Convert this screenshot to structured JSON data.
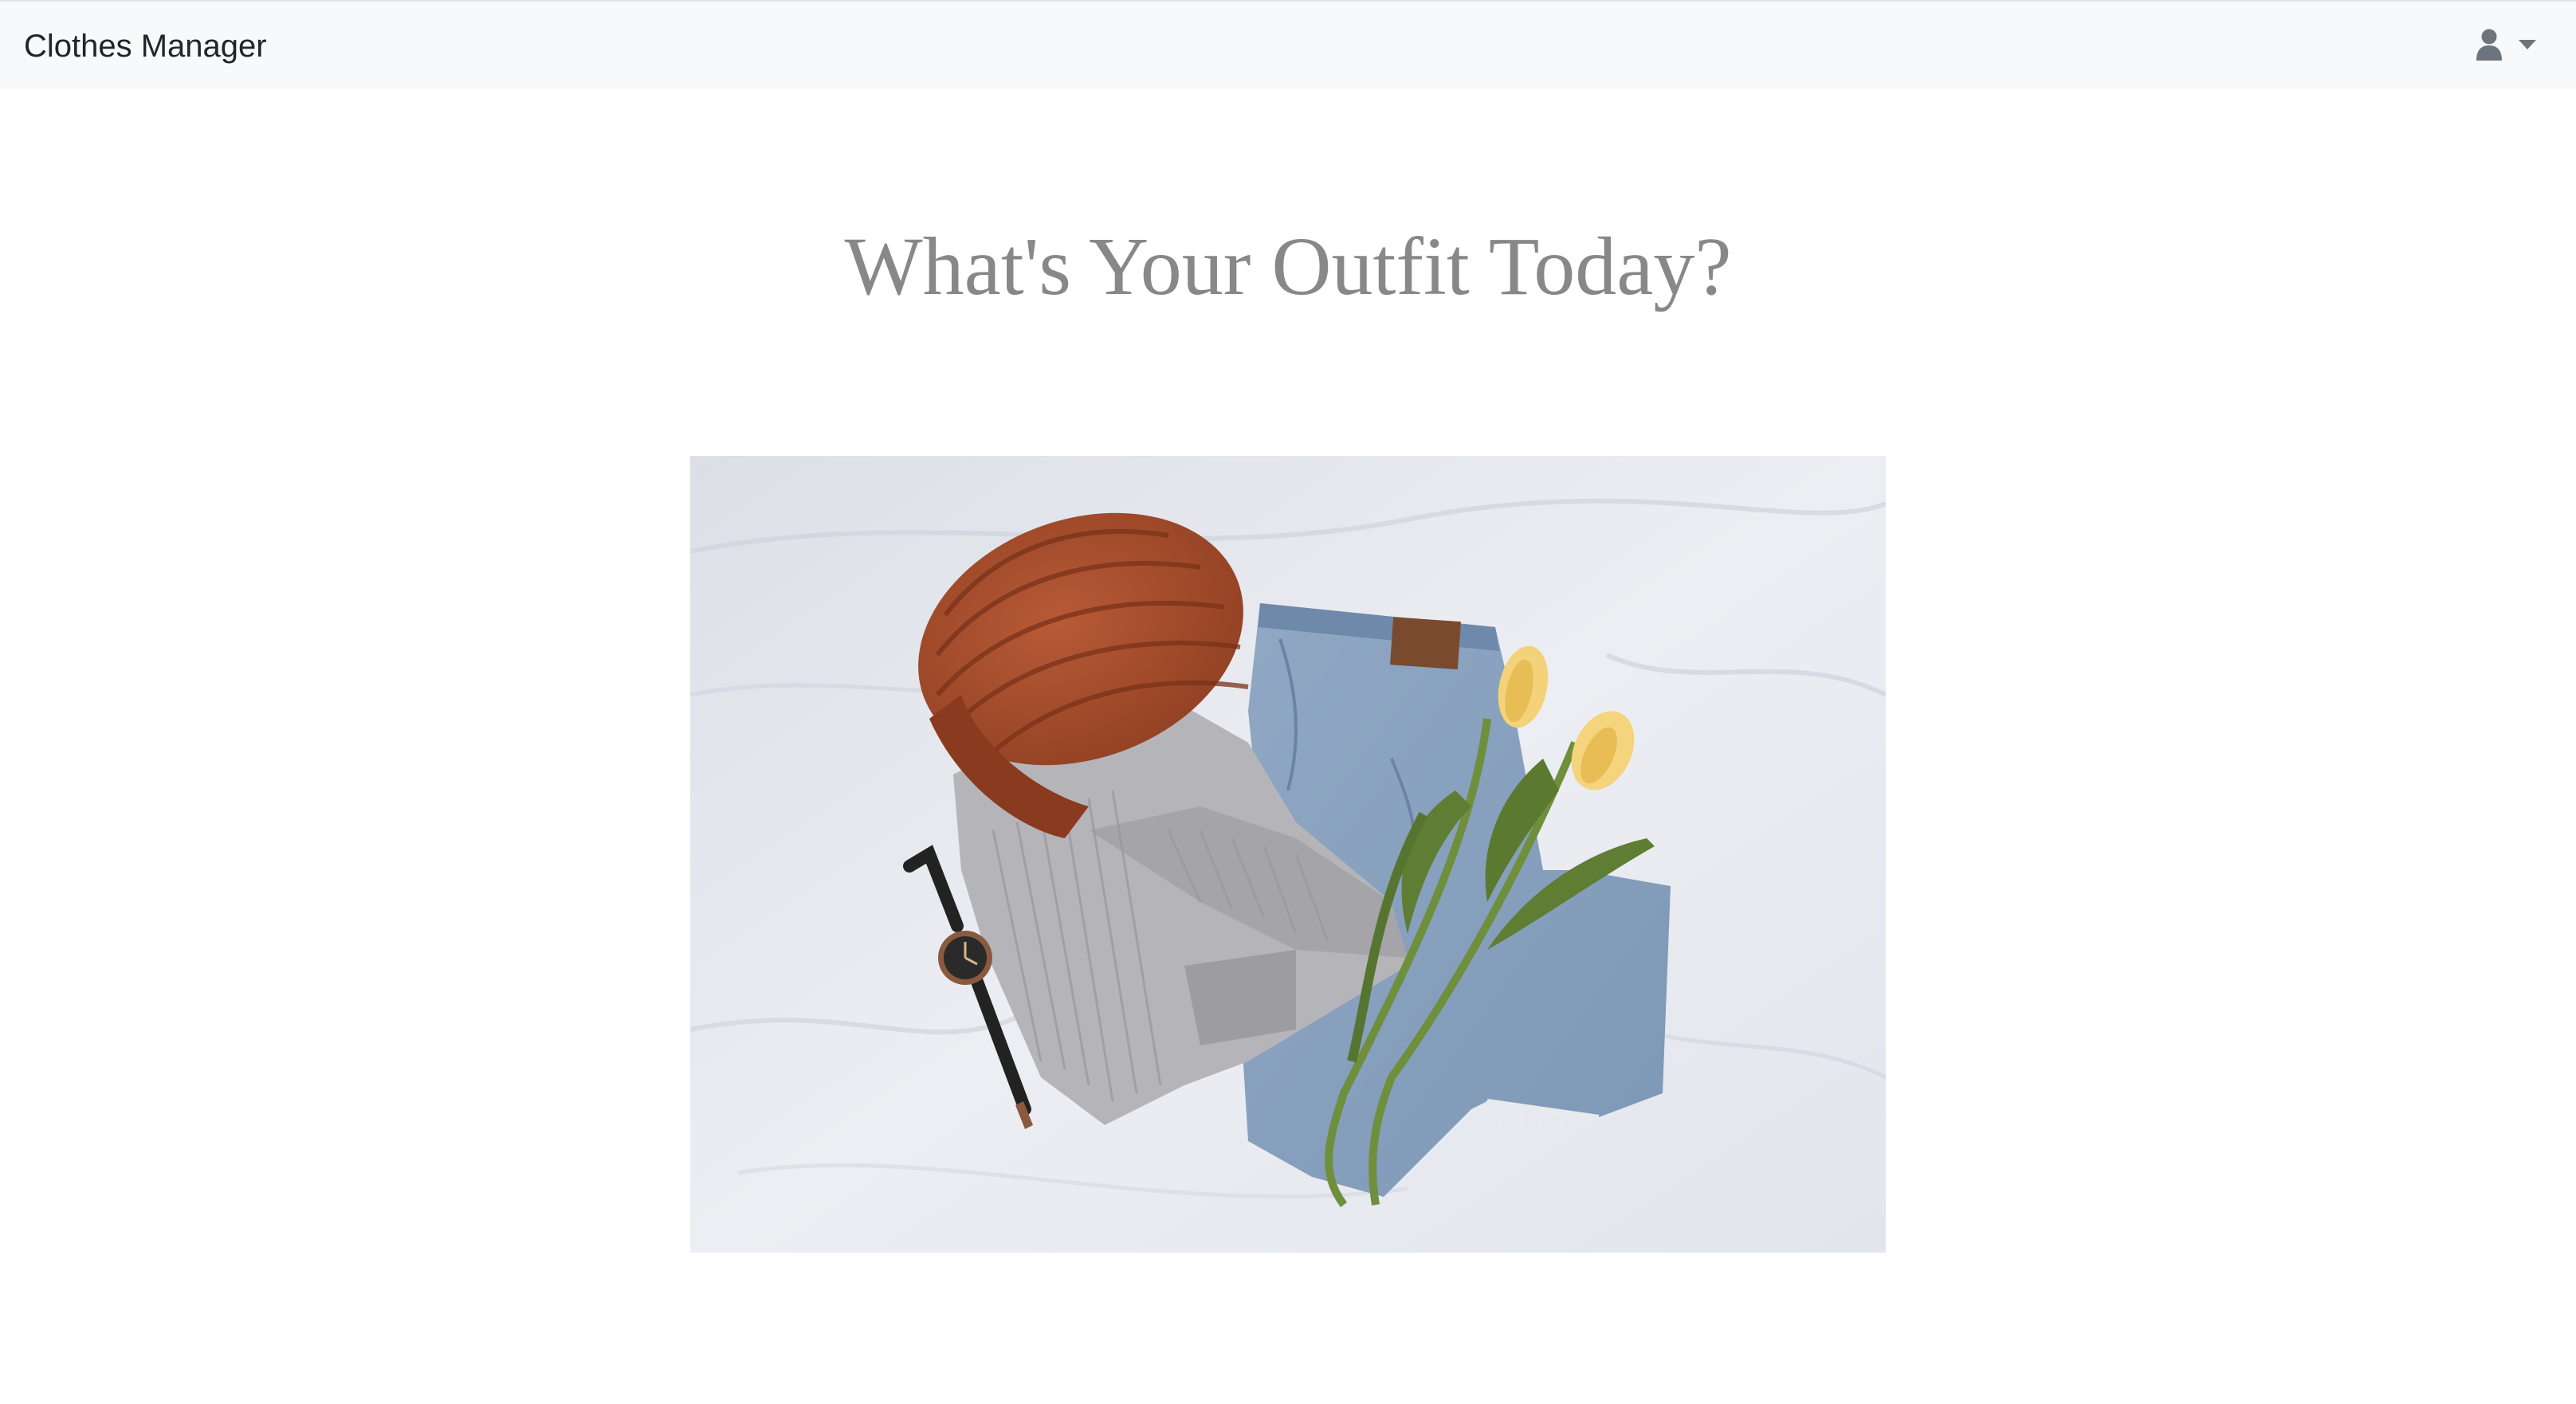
{
  "navbar": {
    "brand": "Clothes Manager",
    "user_icon": "user-icon",
    "dropdown_icon": "caret-down-icon"
  },
  "main": {
    "title": "What's Your Outfit Today?",
    "image": {
      "alt": "Flat lay of knit beanie, grey sweater, jeans, watch and yellow tulips on white sheets"
    }
  },
  "colors": {
    "navbar_bg": "#f8f9fa",
    "title": "#888888",
    "brand_text": "#212529"
  }
}
